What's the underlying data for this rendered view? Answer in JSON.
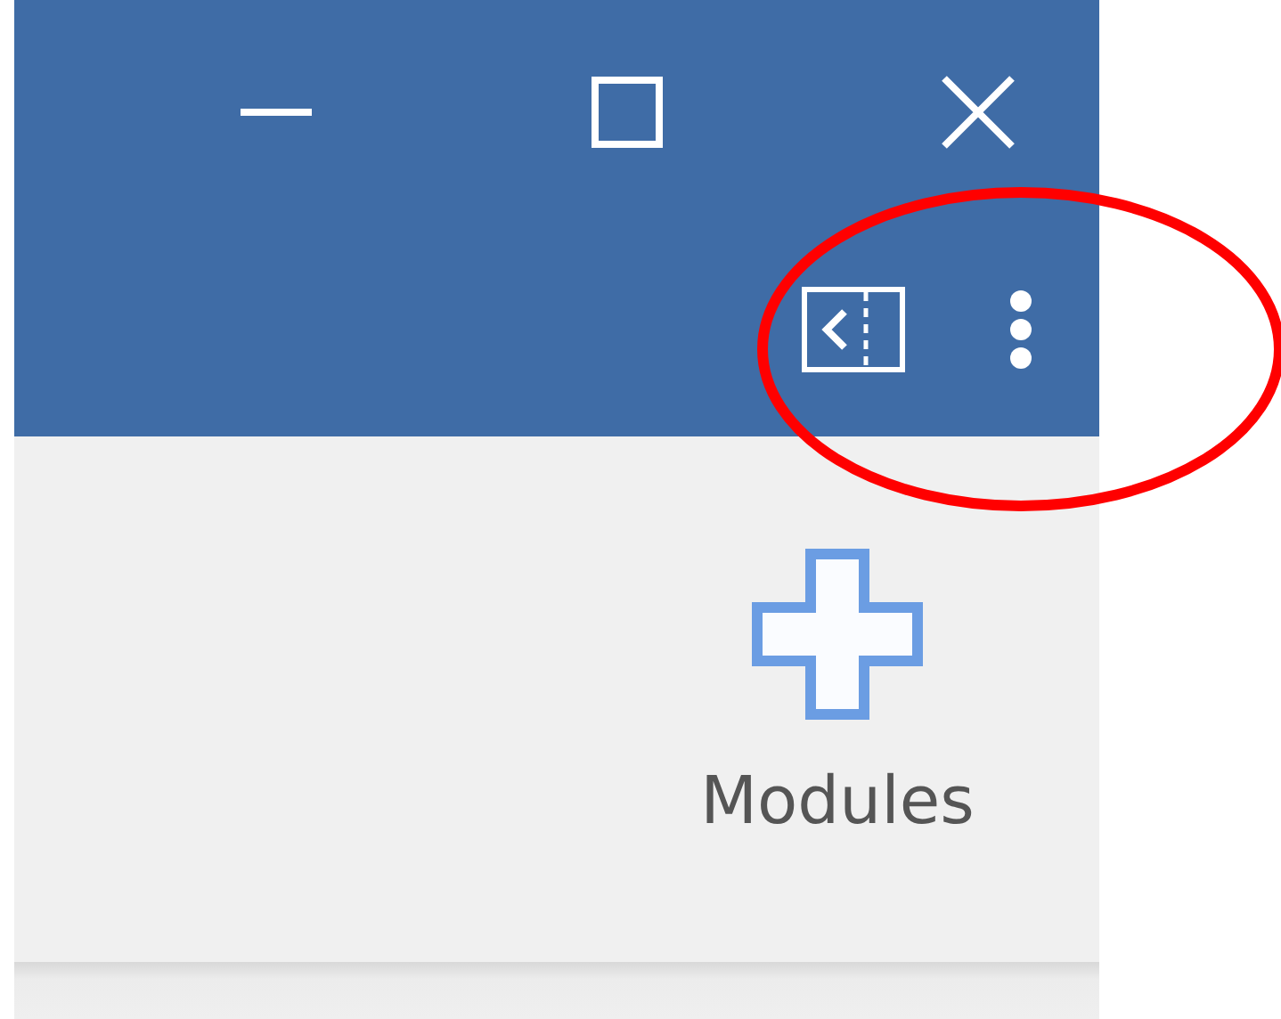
{
  "title_bar": {
    "window_controls": [
      {
        "kind": "minimize"
      },
      {
        "kind": "maximize"
      },
      {
        "kind": "close"
      }
    ],
    "actions": [
      {
        "kind": "panel"
      },
      {
        "kind": "more"
      }
    ]
  },
  "toolbar": {
    "items": [
      {
        "label": "Modules"
      }
    ]
  },
  "annotation": {
    "kind": "ellipse"
  }
}
